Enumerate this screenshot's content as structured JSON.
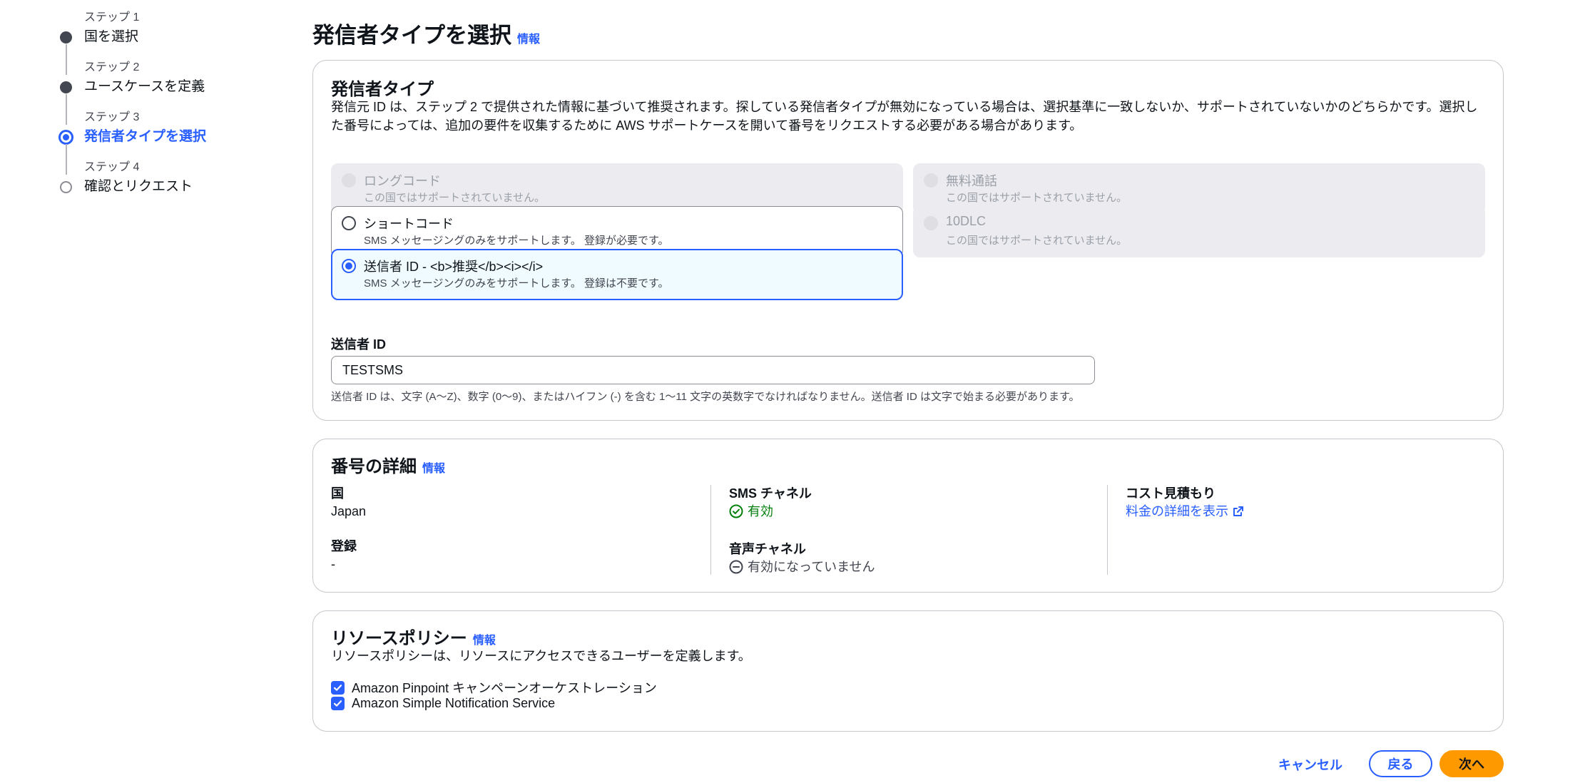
{
  "steps": [
    {
      "num": "ステップ 1",
      "title": "国を選択",
      "state": "done"
    },
    {
      "num": "ステップ 2",
      "title": "ユースケースを定義",
      "state": "done"
    },
    {
      "num": "ステップ 3",
      "title": "発信者タイプを選択",
      "state": "current"
    },
    {
      "num": "ステップ 4",
      "title": "確認とリクエスト",
      "state": "todo"
    }
  ],
  "page": {
    "title": "発信者タイプを選択",
    "info": "情報"
  },
  "sender_card": {
    "title": "発信者タイプ",
    "description": "発信元 ID は、ステップ 2 で提供された情報に基づいて推奨されます。探している発信者タイプが無効になっている場合は、選択基準に一致しないか、サポートされていないかのどちらかです。選択した番号によっては、追加の要件を収集するために AWS サポートケースを開いて番号をリクエストする必要がある場合があります。",
    "options": [
      {
        "label": "ロングコード",
        "desc": "この国ではサポートされていません。",
        "state": "disabled"
      },
      {
        "label": "無料通話",
        "desc": "この国ではサポートされていません。",
        "state": "disabled"
      },
      {
        "label": "ショートコード",
        "desc": "SMS メッセージングのみをサポートします。 登録が必要です。",
        "state": "enabled"
      },
      {
        "label": "10DLC",
        "desc": "この国ではサポートされていません。",
        "state": "disabled"
      },
      {
        "label": "送信者 ID - <b>推奨</b><i></i>",
        "desc": "SMS メッセージングのみをサポートします。 登録は不要です。",
        "state": "selected"
      }
    ],
    "field_label": "送信者 ID",
    "field_value": "TESTSMS",
    "field_hint": "送信者 ID は、文字 (A〜Z)、数字 (0〜9)、またはハイフン (-) を含む 1〜11 文字の英数字でなければなりません。送信者 ID は文字で始まる必要があります。"
  },
  "number_card": {
    "title": "番号の詳細",
    "info": "情報",
    "country_key": "国",
    "country_val": "Japan",
    "registration_key": "登録",
    "registration_val": "-",
    "sms_key": "SMS チャネル",
    "sms_val": "有効",
    "voice_key": "音声チャネル",
    "voice_val": "有効になっていません",
    "cost_key": "コスト見積もり",
    "cost_link": "料金の詳細を表示"
  },
  "policy_card": {
    "title": "リソースポリシー",
    "info": "情報",
    "description": "リソースポリシーは、リソースにアクセスできるユーザーを定義します。",
    "checks": [
      "Amazon Pinpoint キャンペーンオーケストレーション",
      "Amazon Simple Notification Service"
    ]
  },
  "footer": {
    "cancel": "キャンセル",
    "back": "戻る",
    "next": "次へ"
  },
  "colors": {
    "accent": "#295eff",
    "primary_button": "#ff9900",
    "success": "#037f0c"
  }
}
